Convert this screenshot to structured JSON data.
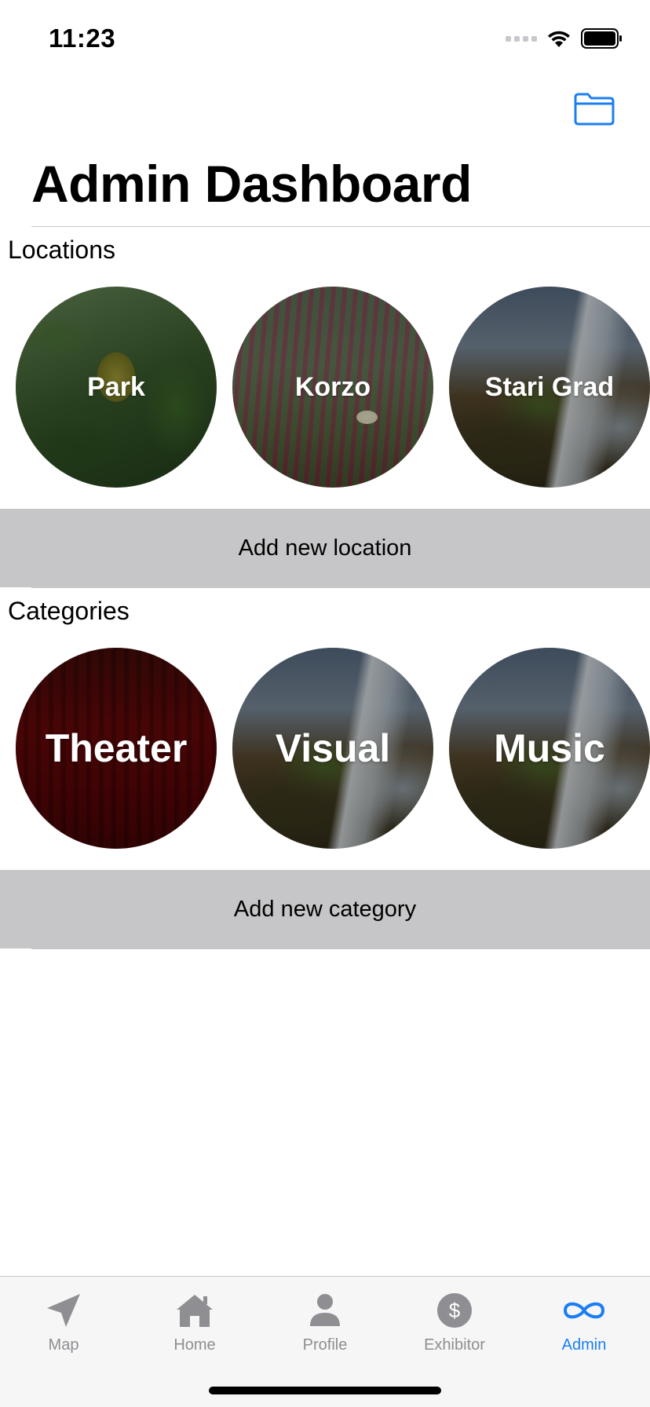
{
  "status_bar": {
    "time": "11:23"
  },
  "nav": {
    "title": "Admin Dashboard",
    "folder_icon": "folder-icon",
    "accent": "#1a7ef3"
  },
  "locations": {
    "heading": "Locations",
    "items": [
      {
        "label": "Park"
      },
      {
        "label": "Korzo"
      },
      {
        "label": "Stari Grad"
      }
    ],
    "add_button": "Add new location"
  },
  "categories": {
    "heading": "Categories",
    "items": [
      {
        "label": "Theater"
      },
      {
        "label": "Visual"
      },
      {
        "label": "Music"
      }
    ],
    "add_button": "Add new category"
  },
  "tab_bar": {
    "active": "Admin",
    "tabs": [
      {
        "label": "Map",
        "icon": "paper-plane-icon"
      },
      {
        "label": "Home",
        "icon": "house-icon"
      },
      {
        "label": "Profile",
        "icon": "person-icon"
      },
      {
        "label": "Exhibitor",
        "icon": "dollar-circle-icon"
      },
      {
        "label": "Admin",
        "icon": "infinity-icon"
      }
    ]
  }
}
